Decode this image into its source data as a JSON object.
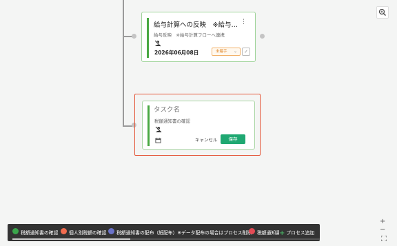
{
  "task_card": {
    "title": "給与計算への反映　※給与計...",
    "subtitle": "給与反映　※給与計算フローへ連携",
    "date": "2026年06月08日",
    "status": "未着手",
    "menu_icon": "⋮"
  },
  "new_task_card": {
    "name_placeholder": "タスク名",
    "subtitle": "税額通知書の確認",
    "cancel_label": "キャンセル",
    "save_label": "保存"
  },
  "zoom": {
    "search_icon": "magnifier-plus-icon",
    "plus": "+",
    "minus": "−",
    "fit": "⛶"
  },
  "process_bar": {
    "items": [
      {
        "label": "税額通知書の確認",
        "color": "#3aa54b"
      },
      {
        "label": "個人別税額の確認",
        "color": "#f26c4f"
      },
      {
        "label": "税額通知書の配布（紙配布）※データ配布の場合はプロセス削除",
        "color": "#6a72c8"
      },
      {
        "label": "税額通知書",
        "color": "#e34b55"
      }
    ],
    "add_label": "プロセス追加"
  }
}
